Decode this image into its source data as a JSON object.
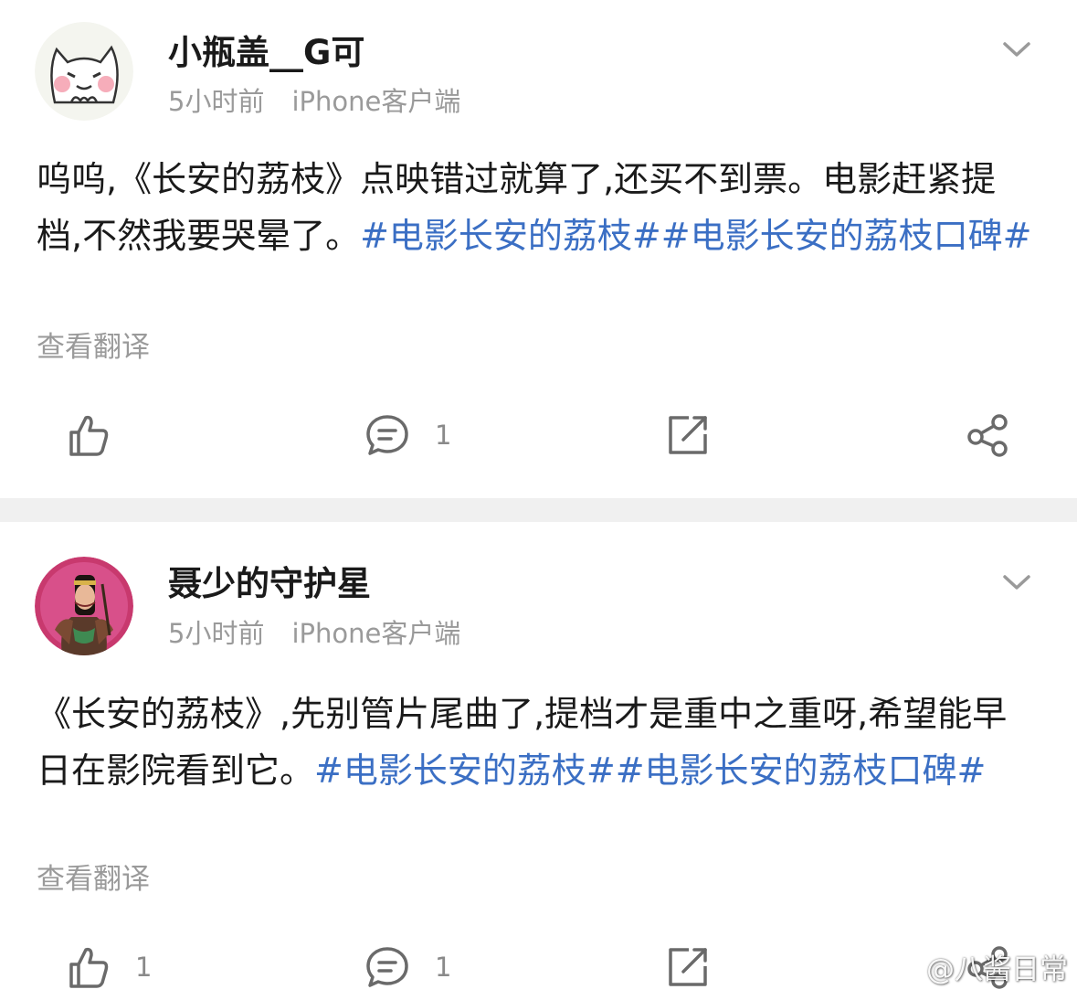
{
  "posts": [
    {
      "username": "小瓶盖__G可",
      "time": "5小时前",
      "source": "iPhone客户端",
      "text": "呜呜,《长安的荔枝》点映错过就算了,还买不到票。电影赶紧提档,不然我要哭晕了。",
      "hashtags": "#电影长安的荔枝##电影长安的荔枝口碑#",
      "translate_label": "查看翻译",
      "like_count": "",
      "comment_count": "1",
      "avatar_icon": "white-cat-avatar",
      "menu_icon": "chevron-down-icon"
    },
    {
      "username": "聂少的守护星",
      "time": "5小时前",
      "source": "iPhone客户端",
      "text": "《长安的荔枝》,先别管片尾曲了,提档才是重中之重呀,希望能早日在影院看到它。",
      "hashtags": "#电影长安的荔枝##电影长安的荔枝口碑#",
      "translate_label": "查看翻译",
      "like_count": "1",
      "comment_count": "1",
      "avatar_icon": "warrior-woman-avatar",
      "menu_icon": "chevron-down-icon"
    }
  ],
  "watermark": {
    "text": "@八酱日常",
    "icon": "weibo-logo-icon"
  },
  "colors": {
    "hashtag": "#3b6fc4",
    "meta": "#9a9a9a",
    "separator": "#f0f0f0"
  }
}
